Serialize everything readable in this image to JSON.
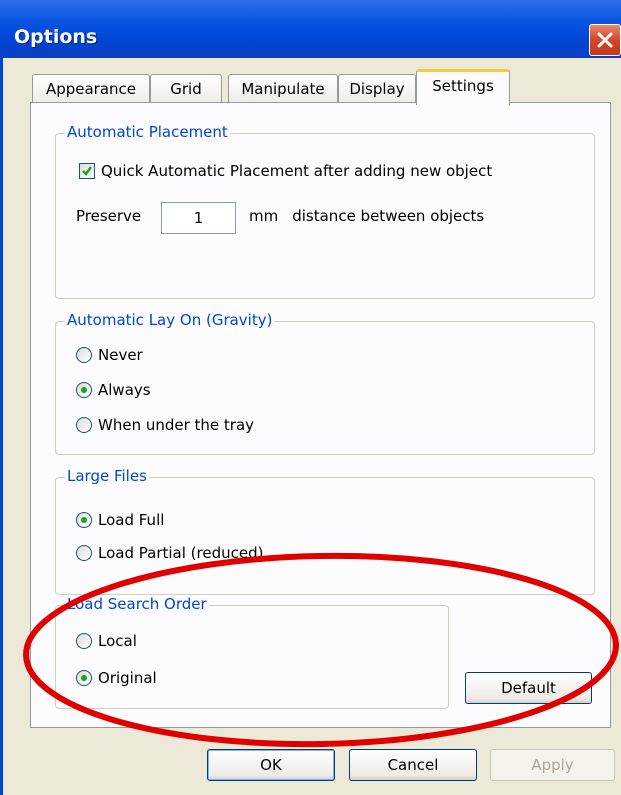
{
  "window": {
    "title": "Options"
  },
  "tabs": [
    {
      "label": "Appearance"
    },
    {
      "label": "Grid"
    },
    {
      "label": "Manipulate"
    },
    {
      "label": "Display"
    },
    {
      "label": "Settings",
      "active": true
    }
  ],
  "auto_placement": {
    "legend": "Automatic Placement",
    "checkbox_label": "Quick Automatic Placement after adding new object",
    "checked": true,
    "preserve_label": "Preserve",
    "distance_value": "1",
    "unit": "mm",
    "suffix": "distance between objects"
  },
  "gravity": {
    "legend": "Automatic Lay On (Gravity)",
    "options": [
      "Never",
      "Always",
      "When under the tray"
    ],
    "selected": "Always"
  },
  "large_files": {
    "legend": "Large Files",
    "options": [
      "Load Full",
      "Load Partial (reduced)"
    ],
    "selected": "Load Full"
  },
  "search_order": {
    "legend": "Load Search Order",
    "options": [
      "Local",
      "Original"
    ],
    "selected": "Original"
  },
  "buttons": {
    "default": "Default",
    "ok": "OK",
    "cancel": "Cancel",
    "apply": "Apply"
  },
  "colors": {
    "title_bar": "#0046d5",
    "legend_text": "#0046d5",
    "annotation": "#e00000",
    "active_tab_accent": "#ffc83c"
  }
}
